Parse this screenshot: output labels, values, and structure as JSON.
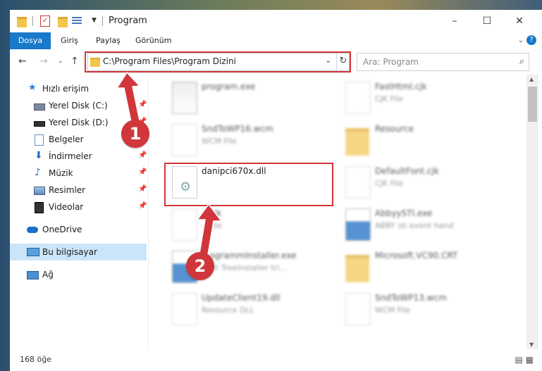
{
  "window": {
    "title": "Program",
    "controls": {
      "minimize": "–",
      "maximize": "☐",
      "close": "✕"
    }
  },
  "ribbon": {
    "file_tab": "Dosya",
    "tabs": [
      "Giriş",
      "Paylaş",
      "Görünüm"
    ]
  },
  "nav": {
    "address": "C:\\Program Files\\Program Dizini",
    "search_placeholder": "Ara: Program"
  },
  "sidebar": {
    "items": [
      {
        "label": "Hızlı erişim",
        "icon": "star-icon"
      },
      {
        "label": "Yerel Disk (C:)",
        "icon": "drive-icon"
      },
      {
        "label": "Yerel Disk (D:)",
        "icon": "drive-icon"
      },
      {
        "label": "Belgeler",
        "icon": "documents-icon"
      },
      {
        "label": "İndirmeler",
        "icon": "download-icon"
      },
      {
        "label": "Müzik",
        "icon": "music-icon"
      },
      {
        "label": "Resimler",
        "icon": "pictures-icon"
      },
      {
        "label": "Videolar",
        "icon": "videos-icon"
      },
      {
        "label": "OneDrive",
        "icon": "cloud-icon"
      },
      {
        "label": "Bu bilgisayar",
        "icon": "computer-icon"
      },
      {
        "label": "Ağ",
        "icon": "network-icon"
      }
    ]
  },
  "files": [
    {
      "name": "program.exe",
      "sub": ""
    },
    {
      "name": "FastHtml.cjk",
      "sub": "CJK File"
    },
    {
      "name": "SndToWP16.wcm",
      "sub": "WCM File"
    },
    {
      "name": "Resource",
      "sub": ""
    },
    {
      "name": "danipci670x.dll",
      "sub": ""
    },
    {
      "name": "DefaultFont.cjk",
      "sub": "CJK File"
    },
    {
      "name": "...cjk",
      "sub": "...File"
    },
    {
      "name": "AbbyySTI.exe",
      "sub": "ABBY sti event hand"
    },
    {
      "name": "...ogrammInstaller.exe",
      "sub": "...BY Treeinstaller tri..."
    },
    {
      "name": "Microsoft.VC90.CRT",
      "sub": ""
    },
    {
      "name": "UpdateClient19.dll",
      "sub": "Resource DLL"
    },
    {
      "name": "SndToWP13.wcm",
      "sub": "WCM File"
    }
  ],
  "status": {
    "count": "168 öğe"
  },
  "annotations": {
    "step1": "1",
    "step2": "2",
    "color": "#d0363a"
  }
}
